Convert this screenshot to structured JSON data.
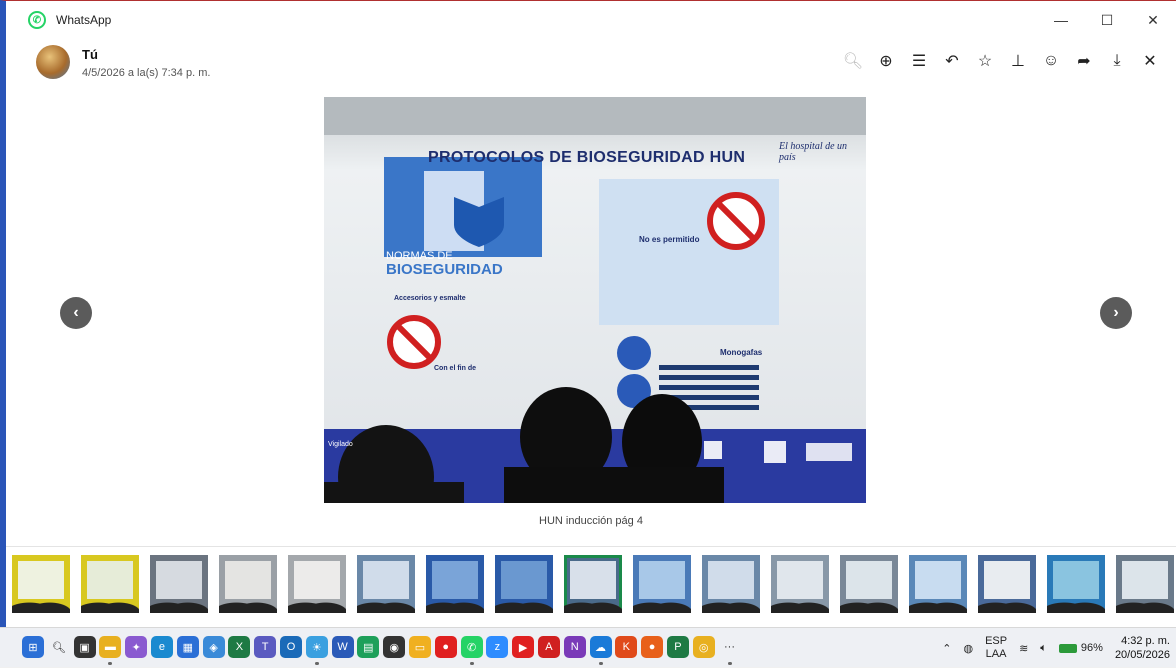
{
  "window": {
    "title": "WhatsApp",
    "controls": [
      "—",
      "☐",
      "✕"
    ]
  },
  "header": {
    "sender": "Tú",
    "timestamp": "4/5/2026 a la(s) 7:34 p. m.",
    "tools": [
      {
        "name": "zoom-out-icon",
        "glyph": "🔍︎",
        "disabled": true
      },
      {
        "name": "zoom-in-icon",
        "glyph": "⊕",
        "disabled": false
      },
      {
        "name": "details-icon",
        "glyph": "☰",
        "disabled": false
      },
      {
        "name": "reply-icon",
        "glyph": "↶",
        "disabled": false
      },
      {
        "name": "star-icon",
        "glyph": "☆",
        "disabled": false
      },
      {
        "name": "pin-icon",
        "glyph": "⊥",
        "disabled": false
      },
      {
        "name": "react-icon",
        "glyph": "☺",
        "disabled": false
      },
      {
        "name": "forward-icon",
        "glyph": "➦",
        "disabled": false
      },
      {
        "name": "download-icon",
        "glyph": "⤓",
        "disabled": false
      },
      {
        "name": "close-icon",
        "glyph": "✕",
        "disabled": false
      }
    ]
  },
  "viewer": {
    "prev": "‹",
    "next": "›",
    "caption": "HUN inducción pág 4"
  },
  "slide": {
    "title": "PROTOCOLOS DE BIOSEGURIDAD HUN",
    "tagline": "El hospital de un país",
    "normas_line1": "NORMAS DE",
    "normas_line2": "BIOSEGURIDAD",
    "accesorios": "Accesorios y esmalte",
    "con_el_fin": "Con el fin de",
    "no_permitido": "No es permitido",
    "monogafas": "Monogafas",
    "vigilado": "Vigilado"
  },
  "thumbnails": [
    {
      "color": "#d8c820",
      "screen": "#eef2e0",
      "selected": false
    },
    {
      "color": "#d8c820",
      "screen": "#e6ecd8",
      "selected": false
    },
    {
      "color": "#6b7480",
      "screen": "#d6dae0",
      "selected": false
    },
    {
      "color": "#9aa0a6",
      "screen": "#e4e4e2",
      "selected": false
    },
    {
      "color": "#a4a8ac",
      "screen": "#ecebea",
      "selected": false
    },
    {
      "color": "#6a88a8",
      "screen": "#d0dcea",
      "selected": false
    },
    {
      "color": "#2a5aa8",
      "screen": "#7aa4d8",
      "selected": false
    },
    {
      "color": "#2a5aa8",
      "screen": "#6a98d0",
      "selected": false
    },
    {
      "color": "#4a6a8a",
      "screen": "#d8e0ea",
      "selected": true
    },
    {
      "color": "#4a7ab8",
      "screen": "#a8c8e8",
      "selected": false
    },
    {
      "color": "#6a88a8",
      "screen": "#d0dcea",
      "selected": false
    },
    {
      "color": "#8898a8",
      "screen": "#e0e6ec",
      "selected": false
    },
    {
      "color": "#7a8898",
      "screen": "#dce4ea",
      "selected": false
    },
    {
      "color": "#5a88b8",
      "screen": "#c8dcf0",
      "selected": false
    },
    {
      "color": "#4a6a9a",
      "screen": "#e8ecf0",
      "selected": false
    },
    {
      "color": "#2a7ab8",
      "screen": "#8ac4e0",
      "selected": false
    },
    {
      "color": "#6a7a8a",
      "screen": "#dce4ea",
      "selected": false
    },
    {
      "color": "#a4a4a4",
      "screen": "#ececec",
      "selected": false
    }
  ],
  "taskbar": {
    "icons": [
      {
        "name": "start-icon",
        "color": "#2b6fd6",
        "glyph": "⊞"
      },
      {
        "name": "search-icon",
        "color": "#eef0f4",
        "glyph": "🔍︎"
      },
      {
        "name": "task-view-icon",
        "color": "#333",
        "glyph": "▣"
      },
      {
        "name": "file-explorer-icon",
        "color": "#e8b020",
        "glyph": "▬"
      },
      {
        "name": "copilot-icon",
        "color": "#8a5ad0",
        "glyph": "✦"
      },
      {
        "name": "edge-icon",
        "color": "#1a8ad0",
        "glyph": "e"
      },
      {
        "name": "store-icon",
        "color": "#2b6fd6",
        "glyph": "▦"
      },
      {
        "name": "photos-icon",
        "color": "#3a8ad8",
        "glyph": "◈"
      },
      {
        "name": "excel-icon",
        "color": "#1e7a44",
        "glyph": "X"
      },
      {
        "name": "teams-icon",
        "color": "#5a5ac0",
        "glyph": "T"
      },
      {
        "name": "outlook-icon",
        "color": "#1a6ab8",
        "glyph": "O"
      },
      {
        "name": "weather-icon",
        "color": "#3aa0e0",
        "glyph": "☀"
      },
      {
        "name": "word-icon",
        "color": "#2a5ab8",
        "glyph": "W"
      },
      {
        "name": "sheets-icon",
        "color": "#1ea05a",
        "glyph": "▤"
      },
      {
        "name": "camera-icon",
        "color": "#333",
        "glyph": "◉"
      },
      {
        "name": "notes-icon",
        "color": "#f0b020",
        "glyph": "▭"
      },
      {
        "name": "record-icon",
        "color": "#e02020",
        "glyph": "●"
      },
      {
        "name": "whatsapp-icon",
        "color": "#25d366",
        "glyph": "✆"
      },
      {
        "name": "zoom-icon",
        "color": "#2d8cff",
        "glyph": "z"
      },
      {
        "name": "youtube-icon",
        "color": "#e02020",
        "glyph": "▶"
      },
      {
        "name": "acrobat-icon",
        "color": "#d02020",
        "glyph": "A"
      },
      {
        "name": "onenote-icon",
        "color": "#7a3ab8",
        "glyph": "N"
      },
      {
        "name": "onedrive-icon",
        "color": "#1a7ad8",
        "glyph": "☁"
      },
      {
        "name": "kahoot-icon",
        "color": "#e04a1a",
        "glyph": "K"
      },
      {
        "name": "firefox-icon",
        "color": "#e8601a",
        "glyph": "●"
      },
      {
        "name": "project-icon",
        "color": "#1e7a44",
        "glyph": "P"
      },
      {
        "name": "chrome-icon",
        "color": "#e8b020",
        "glyph": "◎"
      },
      {
        "name": "more-icon",
        "color": "#eef0f4",
        "glyph": "···"
      }
    ],
    "lang_top": "ESP",
    "lang_bottom": "LAA",
    "battery": "96%",
    "time": "4:32 p. m.",
    "date": "20/05/2026"
  }
}
